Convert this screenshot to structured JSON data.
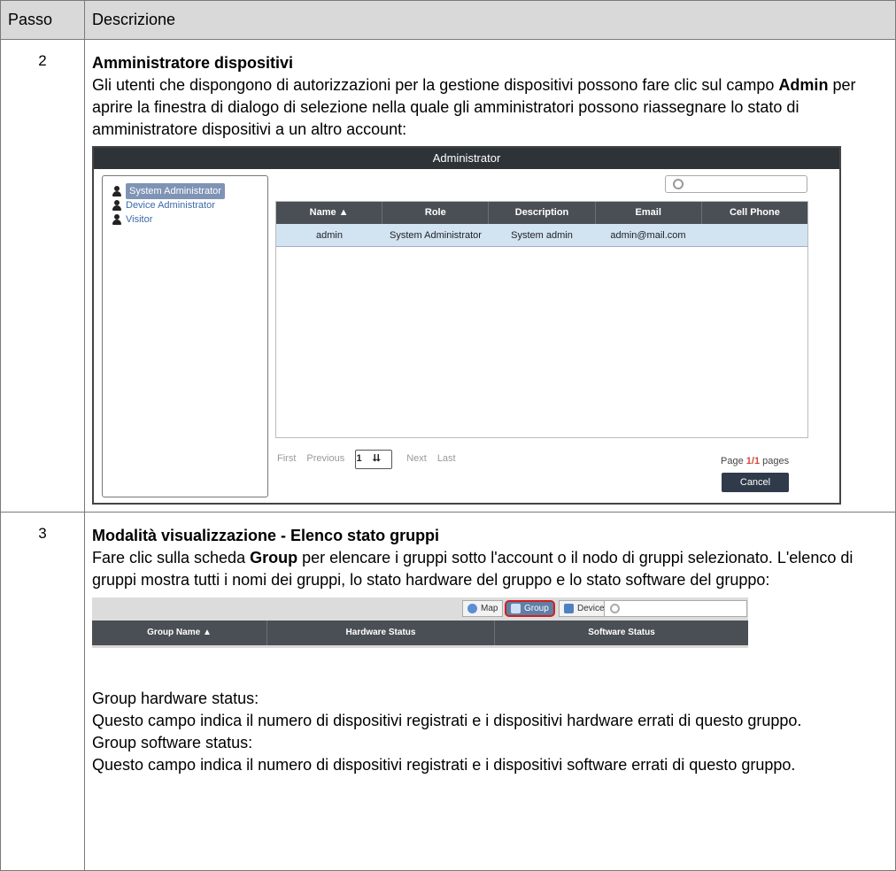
{
  "table": {
    "headers": [
      "Passo",
      "Descrizione"
    ],
    "rows": [
      {
        "step": "2",
        "title": "Amministratore dispositivi",
        "text_before": "Gli utenti che dispongono di autorizzazioni per la gestione dispositivi possono fare clic sul campo ",
        "bold_term": "Admin",
        "text_after": " per aprire la finestra di dialogo di selezione nella quale gli amministratori possono riassegnare lo stato di amministratore dispositivi a un altro account:"
      },
      {
        "step": "3",
        "title": "Modalità visualizzazione - Elenco stato gruppi",
        "text_before": "Fare clic sulla scheda ",
        "bold_term": "Group",
        "text_after": " per elencare i gruppi sotto l'account o il nodo di gruppi selezionato. L'elenco di gruppi mostra tutti i nomi dei gruppi, lo stato hardware del gruppo e lo stato software del gruppo:",
        "notes": [
          "Group hardware status:",
          "Questo campo indica il numero di dispositivi registrati e i dispositivi hardware errati di questo gruppo.",
          "Group software status:",
          "Questo campo indica il numero di dispositivi registrati e i dispositivi software errati di questo gruppo."
        ]
      }
    ]
  },
  "admin_dialog": {
    "title": "Administrator",
    "roles": [
      "System Administrator",
      "Device Administrator",
      "Visitor"
    ],
    "columns": [
      "Name ▲",
      "Role",
      "Description",
      "Email",
      "Cell Phone"
    ],
    "rows": [
      [
        "admin",
        "System Administrator",
        "System admin",
        "admin@mail.com",
        ""
      ]
    ],
    "pager": {
      "first": "First",
      "previous": "Previous",
      "page_select": "1",
      "next": "Next",
      "last": "Last"
    },
    "page_info": {
      "prefix": "Page ",
      "current": "1",
      "sep": "/",
      "total": "1",
      "suffix": " pages"
    },
    "cancel": "Cancel"
  },
  "group_view": {
    "tabs": [
      "Map",
      "Group",
      "Device"
    ],
    "columns": [
      "Group Name ▲",
      "Hardware Status",
      "Software Status"
    ]
  },
  "colors": {
    "header_bg": "#d9d9d9",
    "grid_header": "#4a4f55",
    "selected_row": "#d2e3f2",
    "highlight": "#d02020"
  }
}
